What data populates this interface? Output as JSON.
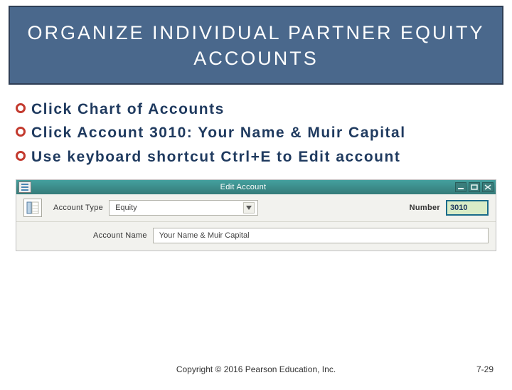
{
  "banner": {
    "line1": "ORGANIZE INDIVIDUAL PARTNER EQUITY",
    "line2": "ACCOUNTS"
  },
  "bullets": [
    "Click Chart of Accounts",
    "Click Account 3010: Your Name & Muir Capital",
    "Use keyboard shortcut Ctrl+E to Edit account"
  ],
  "window": {
    "title": "Edit Account",
    "account_type_label": "Account Type",
    "account_type_value": "Equity",
    "number_label": "Number",
    "number_value": "3010",
    "account_name_label": "Account Name",
    "account_name_value": "Your Name & Muir Capital"
  },
  "footer": {
    "copyright": "Copyright © 2016 Pearson Education, Inc.",
    "page": "7-29"
  }
}
